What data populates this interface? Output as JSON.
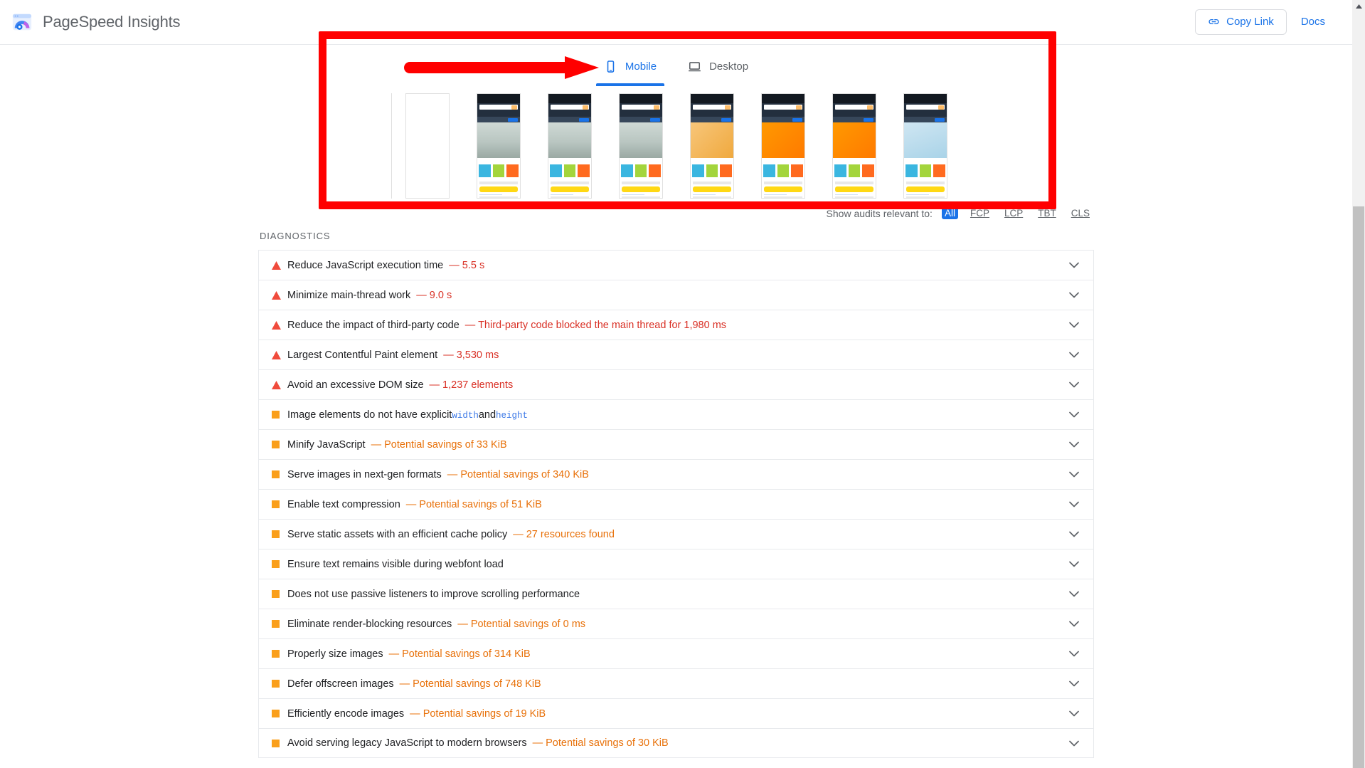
{
  "app": {
    "title": "PageSpeed Insights",
    "logo_icon": "pagespeed-gauge-icon"
  },
  "header": {
    "copy_link_label": "Copy Link",
    "copy_link_icon": "link-icon",
    "docs_label": "Docs"
  },
  "tabs": [
    {
      "label": "Mobile",
      "icon": "mobile-phone-icon",
      "active": true
    },
    {
      "label": "Desktop",
      "icon": "desktop-monitor-icon",
      "active": false
    }
  ],
  "filmstrip": {
    "frames": [
      {
        "state": "blank",
        "hero": "blank-hero"
      },
      {
        "state": "loaded",
        "hero": "a"
      },
      {
        "state": "loaded",
        "hero": "a"
      },
      {
        "state": "loaded",
        "hero": "a"
      },
      {
        "state": "loaded",
        "hero": "b"
      },
      {
        "state": "loaded",
        "hero": "c"
      },
      {
        "state": "loaded",
        "hero": "c"
      },
      {
        "state": "loaded",
        "hero": "d"
      }
    ]
  },
  "relevance": {
    "label": "Show audits relevant to:",
    "options": [
      {
        "label": "All",
        "selected": true
      },
      {
        "label": "FCP",
        "selected": false
      },
      {
        "label": "LCP",
        "selected": false
      },
      {
        "label": "TBT",
        "selected": false
      },
      {
        "label": "CLS",
        "selected": false
      }
    ]
  },
  "diagnostics": {
    "heading": "DIAGNOSTICS",
    "audits": [
      {
        "severity": "fail",
        "title": "Reduce JavaScript execution time",
        "value": "— 5.5 s"
      },
      {
        "severity": "fail",
        "title": "Minimize main-thread work",
        "value": "— 9.0 s"
      },
      {
        "severity": "fail",
        "title": "Reduce the impact of third-party code",
        "value": "— Third-party code blocked the main thread for 1,980 ms"
      },
      {
        "severity": "fail",
        "title": "Largest Contentful Paint element",
        "value": "— 3,530 ms"
      },
      {
        "severity": "fail",
        "title": "Avoid an excessive DOM size",
        "value": "— 1,237 elements"
      },
      {
        "severity": "average",
        "title_parts": [
          "Image elements do not have explicit ",
          "width",
          " and ",
          "height"
        ],
        "title": "Image elements do not have explicit width and height",
        "value": ""
      },
      {
        "severity": "average",
        "title": "Minify JavaScript",
        "value": "— Potential savings of 33 KiB"
      },
      {
        "severity": "average",
        "title": "Serve images in next-gen formats",
        "value": "— Potential savings of 340 KiB"
      },
      {
        "severity": "average",
        "title": "Enable text compression",
        "value": "— Potential savings of 51 KiB"
      },
      {
        "severity": "average",
        "title": "Serve static assets with an efficient cache policy",
        "value": "— 27 resources found"
      },
      {
        "severity": "average",
        "title": "Ensure text remains visible during webfont load",
        "value": ""
      },
      {
        "severity": "average",
        "title": "Does not use passive listeners to improve scrolling performance",
        "value": ""
      },
      {
        "severity": "average",
        "title": "Eliminate render-blocking resources",
        "value": "— Potential savings of 0 ms"
      },
      {
        "severity": "average",
        "title": "Properly size images",
        "value": "— Potential savings of 314 KiB"
      },
      {
        "severity": "average",
        "title": "Defer offscreen images",
        "value": "— Potential savings of 748 KiB"
      },
      {
        "severity": "average",
        "title": "Efficiently encode images",
        "value": "— Potential savings of 19 KiB"
      },
      {
        "severity": "average",
        "title": "Avoid serving legacy JavaScript to modern browsers",
        "value": "— Potential savings of 30 KiB"
      }
    ]
  },
  "annotations": {
    "highlight_color": "#ff0000",
    "arrow_icon": "red-arrow-right",
    "box_icon": "red-highlight-box"
  },
  "colors": {
    "accent_blue": "#1a73e8",
    "fail_red": "#d93025",
    "average_orange": "#e8710a",
    "text_primary": "#202124",
    "text_secondary": "#5f6368",
    "annotation_red": "#ff0000"
  }
}
